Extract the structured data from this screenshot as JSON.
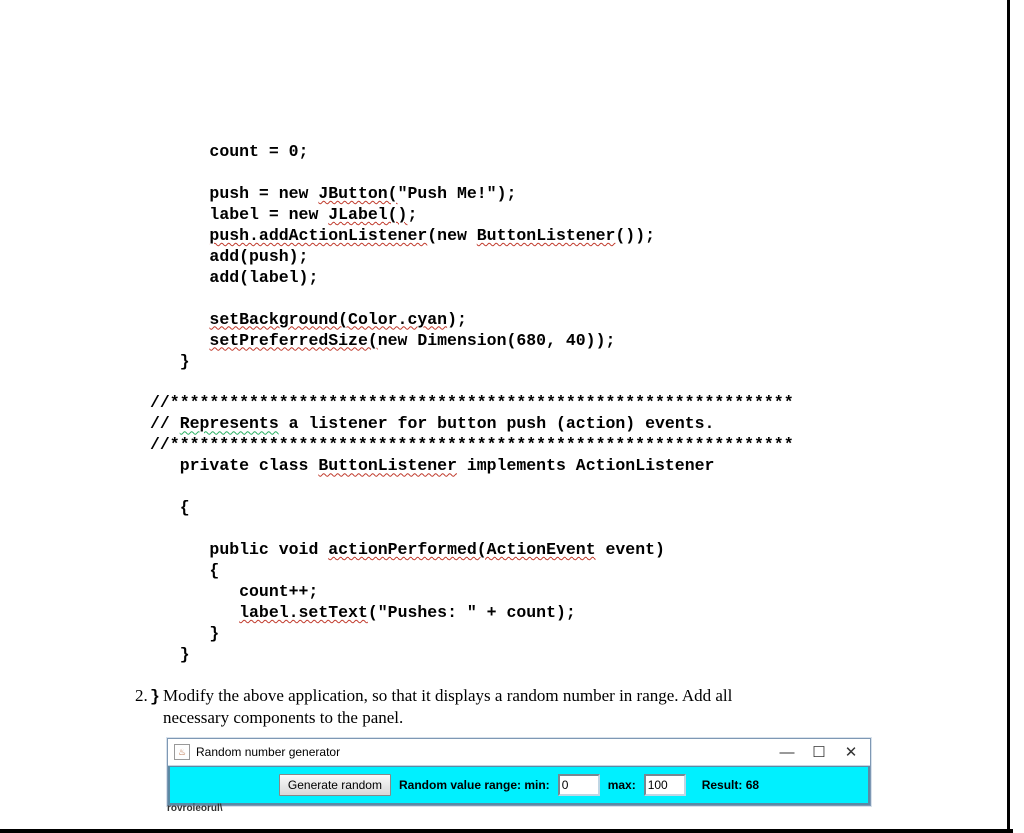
{
  "code": {
    "declare": "count = 0;",
    "push_new": "push = new ",
    "jbutton": "JButton(",
    "push_arg": "\"Push Me!\");",
    "label_new": "label = new ",
    "jlabel": "JLabel()",
    "semi": ";",
    "push_add1": "push.addActionListener",
    "push_add2": "(new ",
    "btnlistener": "ButtonListener",
    "push_add3": "());",
    "addpush": "add(push);",
    "addlabel": "add(label);",
    "setbg": "setBackground(Color.cyan",
    "close": ");",
    "setpref": "setPreferredSize(",
    "dim": "new Dimension(680, 40));",
    "brace_close1": "}",
    "comment_stars": "//***************************************************************",
    "repcomment1": "// ",
    "repword": "Represents",
    "repcomment2": " a listener for button push (action) events.",
    "privclass1": "private class ",
    "btnlistener2": "ButtonListener",
    "privclass2": " implements ActionListener",
    "obrace": "{",
    "pubvoid1": "public void ",
    "actperf": "actionPerformed(ActionEvent",
    "pubvoid2": " event)",
    "countpp": "count++;",
    "lblset": "label.setText",
    "lblset2": "(\"Pushes: \" + count);"
  },
  "task": {
    "number": "2.",
    "line1": "Modify the above application, so that it displays a random number in range. Add all",
    "line2": "necessary components to the panel."
  },
  "window": {
    "title": "Random number generator",
    "button": "Generate random",
    "rangelabel": "Random value range:  min:",
    "minval": "0",
    "maxlabel": "max:",
    "maxval": "100",
    "resultlabel": "Result: 68"
  },
  "garble": "rovroieorul\\"
}
